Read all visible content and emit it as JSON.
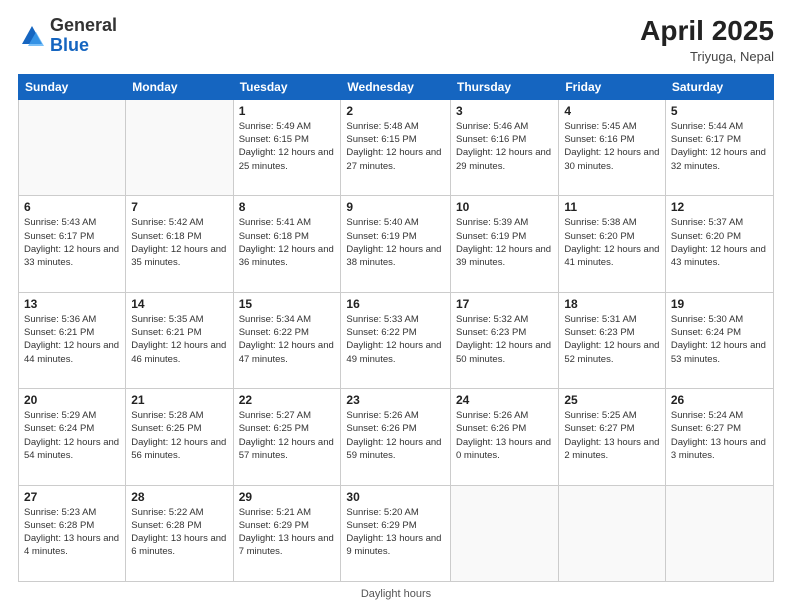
{
  "header": {
    "logo_general": "General",
    "logo_blue": "Blue",
    "month_title": "April 2025",
    "subtitle": "Triyuga, Nepal"
  },
  "days_of_week": [
    "Sunday",
    "Monday",
    "Tuesday",
    "Wednesday",
    "Thursday",
    "Friday",
    "Saturday"
  ],
  "footer": {
    "daylight_hours": "Daylight hours"
  },
  "weeks": [
    [
      {
        "day": "",
        "empty": true
      },
      {
        "day": "",
        "empty": true
      },
      {
        "day": "1",
        "sunrise": "Sunrise: 5:49 AM",
        "sunset": "Sunset: 6:15 PM",
        "daylight": "Daylight: 12 hours and 25 minutes."
      },
      {
        "day": "2",
        "sunrise": "Sunrise: 5:48 AM",
        "sunset": "Sunset: 6:15 PM",
        "daylight": "Daylight: 12 hours and 27 minutes."
      },
      {
        "day": "3",
        "sunrise": "Sunrise: 5:46 AM",
        "sunset": "Sunset: 6:16 PM",
        "daylight": "Daylight: 12 hours and 29 minutes."
      },
      {
        "day": "4",
        "sunrise": "Sunrise: 5:45 AM",
        "sunset": "Sunset: 6:16 PM",
        "daylight": "Daylight: 12 hours and 30 minutes."
      },
      {
        "day": "5",
        "sunrise": "Sunrise: 5:44 AM",
        "sunset": "Sunset: 6:17 PM",
        "daylight": "Daylight: 12 hours and 32 minutes."
      }
    ],
    [
      {
        "day": "6",
        "sunrise": "Sunrise: 5:43 AM",
        "sunset": "Sunset: 6:17 PM",
        "daylight": "Daylight: 12 hours and 33 minutes."
      },
      {
        "day": "7",
        "sunrise": "Sunrise: 5:42 AM",
        "sunset": "Sunset: 6:18 PM",
        "daylight": "Daylight: 12 hours and 35 minutes."
      },
      {
        "day": "8",
        "sunrise": "Sunrise: 5:41 AM",
        "sunset": "Sunset: 6:18 PM",
        "daylight": "Daylight: 12 hours and 36 minutes."
      },
      {
        "day": "9",
        "sunrise": "Sunrise: 5:40 AM",
        "sunset": "Sunset: 6:19 PM",
        "daylight": "Daylight: 12 hours and 38 minutes."
      },
      {
        "day": "10",
        "sunrise": "Sunrise: 5:39 AM",
        "sunset": "Sunset: 6:19 PM",
        "daylight": "Daylight: 12 hours and 39 minutes."
      },
      {
        "day": "11",
        "sunrise": "Sunrise: 5:38 AM",
        "sunset": "Sunset: 6:20 PM",
        "daylight": "Daylight: 12 hours and 41 minutes."
      },
      {
        "day": "12",
        "sunrise": "Sunrise: 5:37 AM",
        "sunset": "Sunset: 6:20 PM",
        "daylight": "Daylight: 12 hours and 43 minutes."
      }
    ],
    [
      {
        "day": "13",
        "sunrise": "Sunrise: 5:36 AM",
        "sunset": "Sunset: 6:21 PM",
        "daylight": "Daylight: 12 hours and 44 minutes."
      },
      {
        "day": "14",
        "sunrise": "Sunrise: 5:35 AM",
        "sunset": "Sunset: 6:21 PM",
        "daylight": "Daylight: 12 hours and 46 minutes."
      },
      {
        "day": "15",
        "sunrise": "Sunrise: 5:34 AM",
        "sunset": "Sunset: 6:22 PM",
        "daylight": "Daylight: 12 hours and 47 minutes."
      },
      {
        "day": "16",
        "sunrise": "Sunrise: 5:33 AM",
        "sunset": "Sunset: 6:22 PM",
        "daylight": "Daylight: 12 hours and 49 minutes."
      },
      {
        "day": "17",
        "sunrise": "Sunrise: 5:32 AM",
        "sunset": "Sunset: 6:23 PM",
        "daylight": "Daylight: 12 hours and 50 minutes."
      },
      {
        "day": "18",
        "sunrise": "Sunrise: 5:31 AM",
        "sunset": "Sunset: 6:23 PM",
        "daylight": "Daylight: 12 hours and 52 minutes."
      },
      {
        "day": "19",
        "sunrise": "Sunrise: 5:30 AM",
        "sunset": "Sunset: 6:24 PM",
        "daylight": "Daylight: 12 hours and 53 minutes."
      }
    ],
    [
      {
        "day": "20",
        "sunrise": "Sunrise: 5:29 AM",
        "sunset": "Sunset: 6:24 PM",
        "daylight": "Daylight: 12 hours and 54 minutes."
      },
      {
        "day": "21",
        "sunrise": "Sunrise: 5:28 AM",
        "sunset": "Sunset: 6:25 PM",
        "daylight": "Daylight: 12 hours and 56 minutes."
      },
      {
        "day": "22",
        "sunrise": "Sunrise: 5:27 AM",
        "sunset": "Sunset: 6:25 PM",
        "daylight": "Daylight: 12 hours and 57 minutes."
      },
      {
        "day": "23",
        "sunrise": "Sunrise: 5:26 AM",
        "sunset": "Sunset: 6:26 PM",
        "daylight": "Daylight: 12 hours and 59 minutes."
      },
      {
        "day": "24",
        "sunrise": "Sunrise: 5:26 AM",
        "sunset": "Sunset: 6:26 PM",
        "daylight": "Daylight: 13 hours and 0 minutes."
      },
      {
        "day": "25",
        "sunrise": "Sunrise: 5:25 AM",
        "sunset": "Sunset: 6:27 PM",
        "daylight": "Daylight: 13 hours and 2 minutes."
      },
      {
        "day": "26",
        "sunrise": "Sunrise: 5:24 AM",
        "sunset": "Sunset: 6:27 PM",
        "daylight": "Daylight: 13 hours and 3 minutes."
      }
    ],
    [
      {
        "day": "27",
        "sunrise": "Sunrise: 5:23 AM",
        "sunset": "Sunset: 6:28 PM",
        "daylight": "Daylight: 13 hours and 4 minutes."
      },
      {
        "day": "28",
        "sunrise": "Sunrise: 5:22 AM",
        "sunset": "Sunset: 6:28 PM",
        "daylight": "Daylight: 13 hours and 6 minutes."
      },
      {
        "day": "29",
        "sunrise": "Sunrise: 5:21 AM",
        "sunset": "Sunset: 6:29 PM",
        "daylight": "Daylight: 13 hours and 7 minutes."
      },
      {
        "day": "30",
        "sunrise": "Sunrise: 5:20 AM",
        "sunset": "Sunset: 6:29 PM",
        "daylight": "Daylight: 13 hours and 9 minutes."
      },
      {
        "day": "",
        "empty": true
      },
      {
        "day": "",
        "empty": true
      },
      {
        "day": "",
        "empty": true
      }
    ]
  ]
}
